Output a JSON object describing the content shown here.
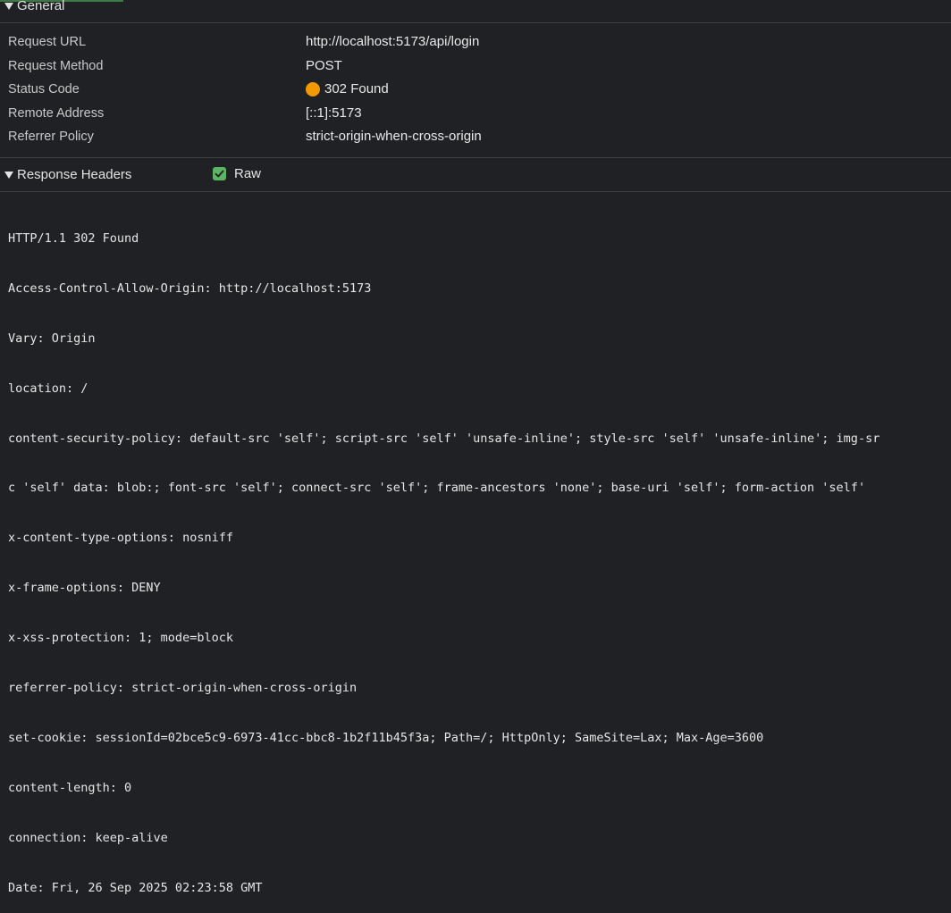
{
  "general": {
    "title": "General",
    "rows": [
      {
        "label": "Request URL",
        "value": "http://localhost:5173/api/login"
      },
      {
        "label": "Request Method",
        "value": "POST"
      },
      {
        "label": "Status Code",
        "value": "302 Found"
      },
      {
        "label": "Remote Address",
        "value": "[::1]:5173"
      },
      {
        "label": "Referrer Policy",
        "value": "strict-origin-when-cross-origin"
      }
    ],
    "status_dot_color": "#f29900"
  },
  "response_headers": {
    "title": "Response Headers",
    "raw_label": "Raw",
    "raw_checked": true,
    "lines": [
      "HTTP/1.1 302 Found",
      "Access-Control-Allow-Origin: http://localhost:5173",
      "Vary: Origin",
      "location: /",
      "content-security-policy: default-src 'self'; script-src 'self' 'unsafe-inline'; style-src 'self' 'unsafe-inline'; img-sr",
      "c 'self' data: blob:; font-src 'self'; connect-src 'self'; frame-ancestors 'none'; base-uri 'self'; form-action 'self'",
      "x-content-type-options: nosniff",
      "x-frame-options: DENY",
      "x-xss-protection: 1; mode=block",
      "referrer-policy: strict-origin-when-cross-origin",
      "set-cookie: sessionId=02bce5c9-6973-41cc-bbc8-1b2f11b45f3a; Path=/; HttpOnly; SameSite=Lax; Max-Age=3600",
      "content-length: 0",
      "connection: keep-alive",
      "Date: Fri, 26 Sep 2025 02:23:58 GMT"
    ]
  },
  "colors": {
    "background": "#202124",
    "checkbox": "#5eb465",
    "accent_tab": "#3b7a42"
  }
}
